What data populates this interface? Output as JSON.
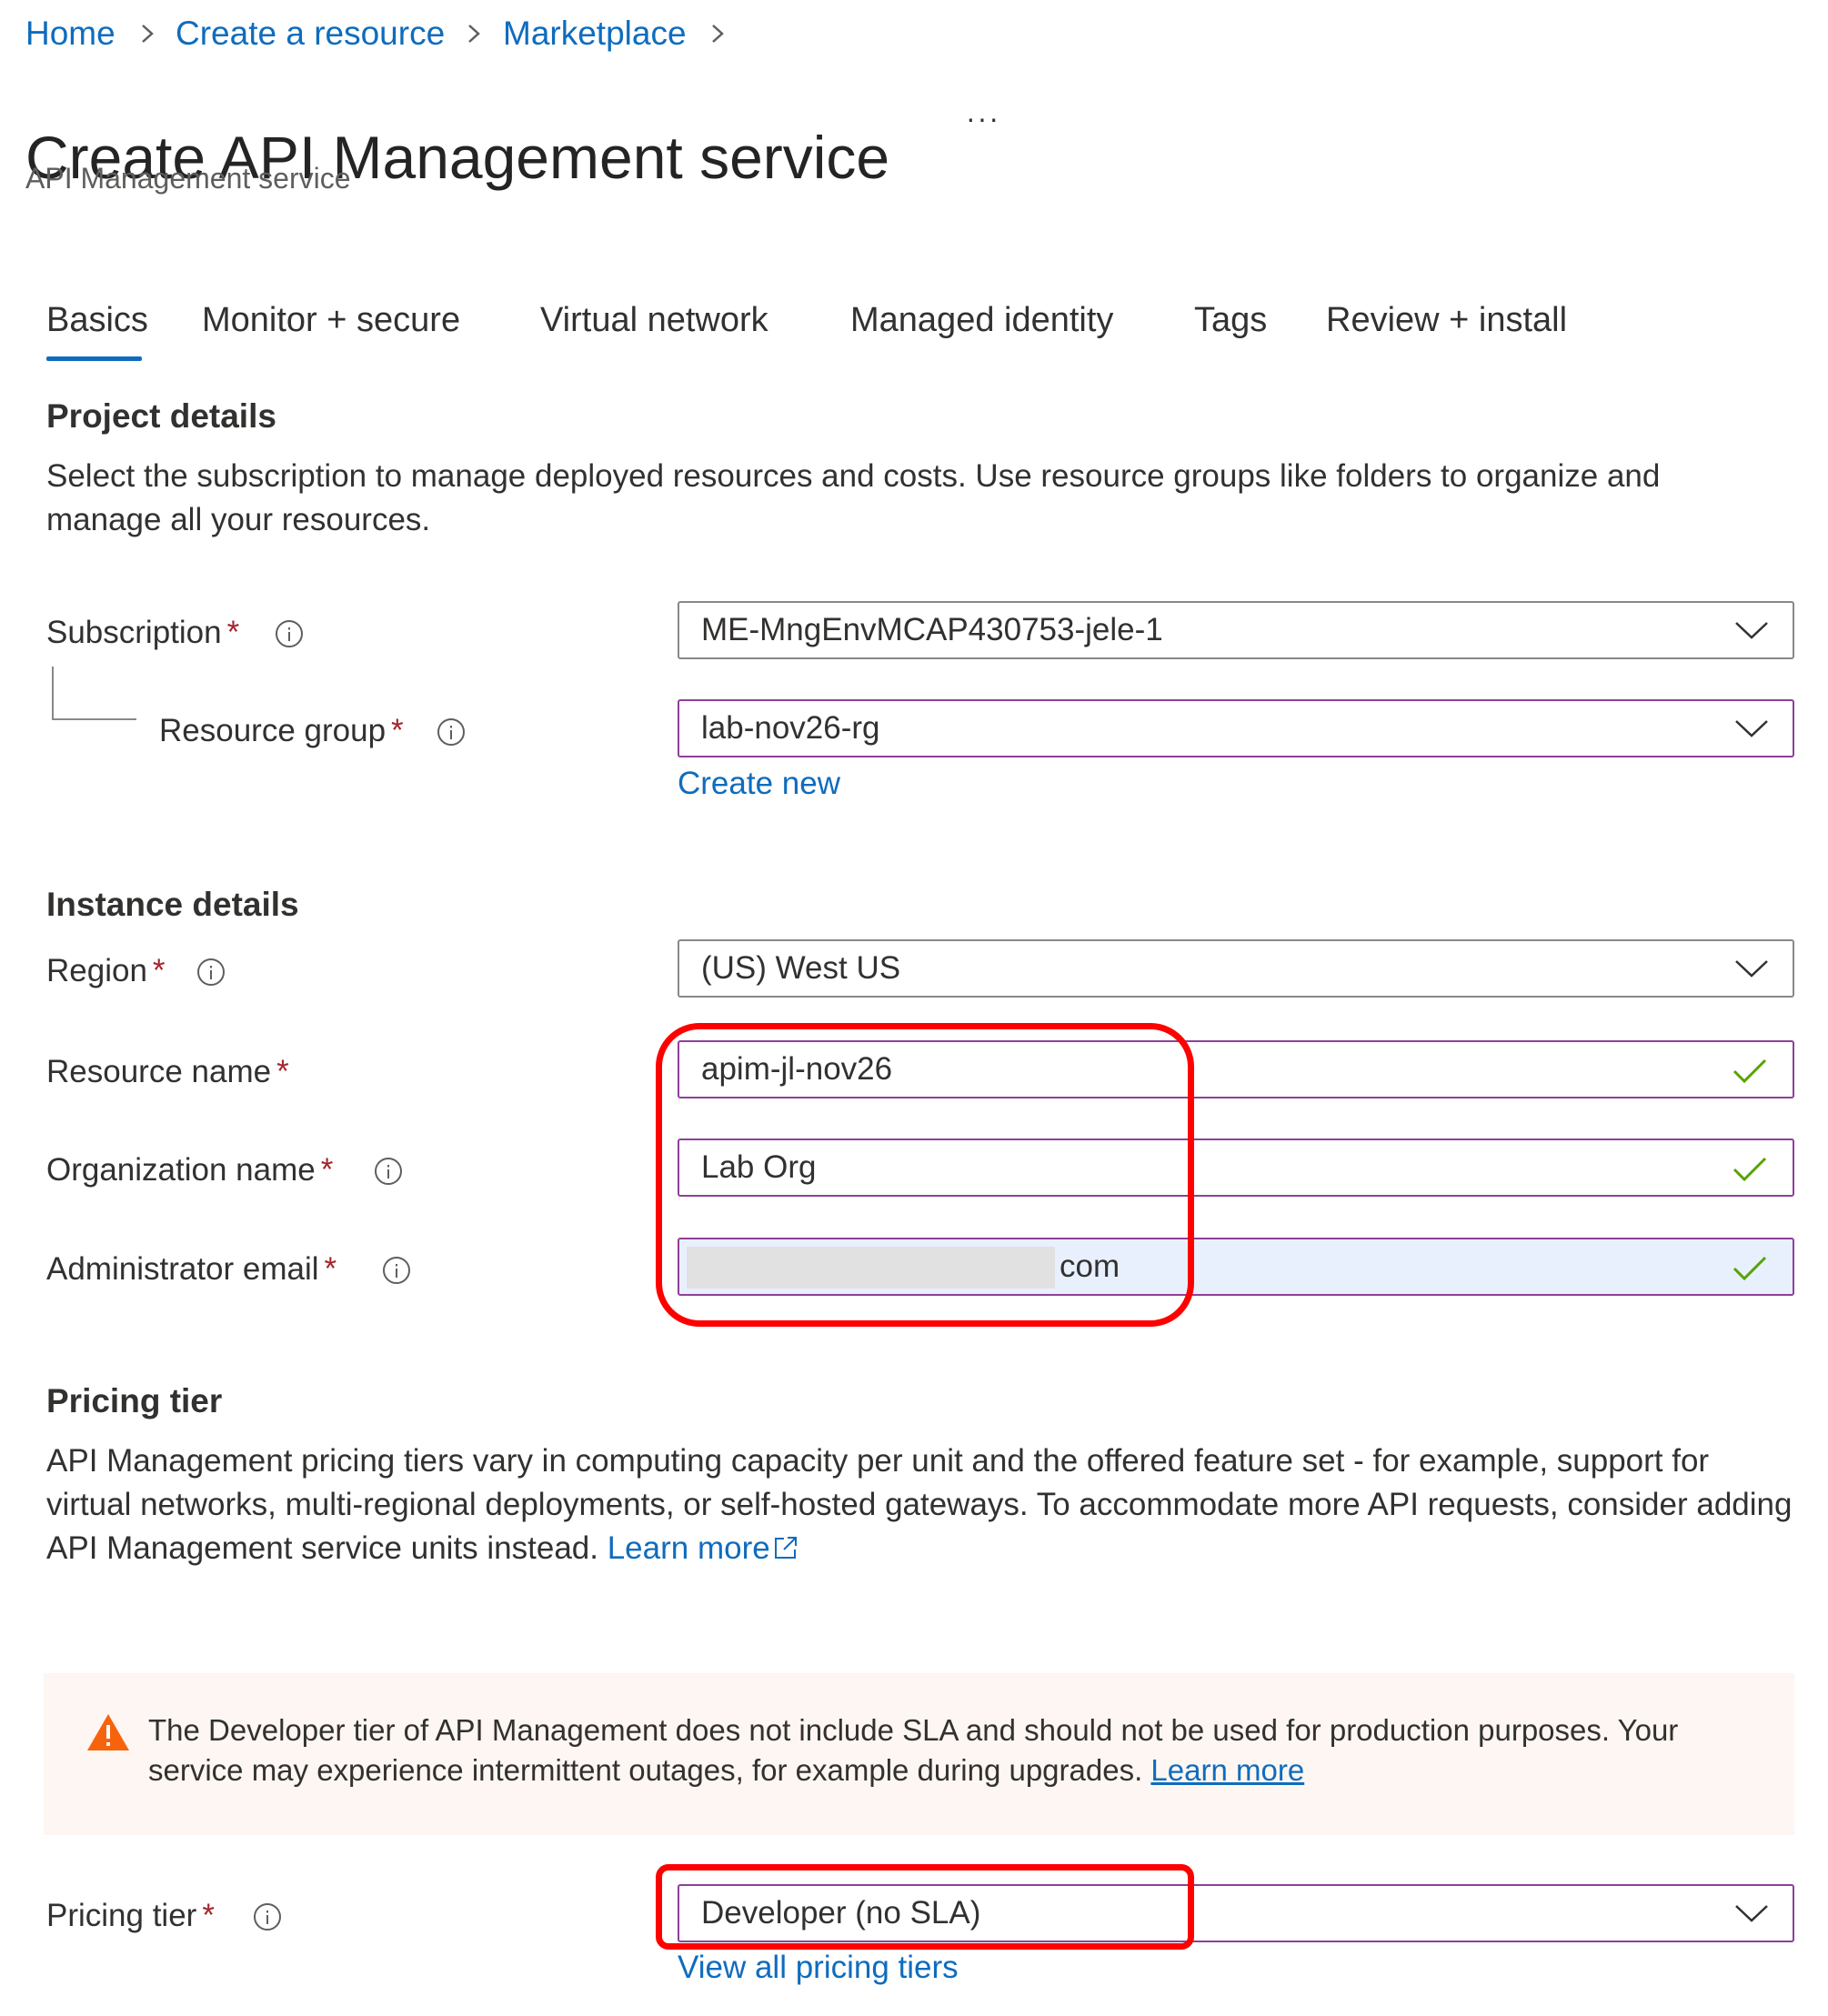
{
  "breadcrumb": {
    "items": [
      {
        "label": "Home"
      },
      {
        "label": "Create a resource"
      },
      {
        "label": "Marketplace"
      }
    ],
    "separator": ">"
  },
  "header": {
    "title": "Create API Management service",
    "more_label": "···",
    "subtitle": "API Management service"
  },
  "tabs": [
    {
      "label": "Basics",
      "active": true
    },
    {
      "label": "Monitor + secure"
    },
    {
      "label": "Virtual network"
    },
    {
      "label": "Managed identity"
    },
    {
      "label": "Tags"
    },
    {
      "label": "Review + install"
    }
  ],
  "project_details": {
    "title": "Project details",
    "description": "Select the subscription to manage deployed resources and costs. Use resource groups like folders to organize and manage all your resources.",
    "subscription": {
      "label": "Subscription",
      "required": "*",
      "value": "ME-MngEnvMCAP430753-jele-1"
    },
    "resource_group": {
      "label": "Resource group",
      "required": "*",
      "value": "lab-nov26-rg",
      "create_new": "Create new"
    }
  },
  "instance_details": {
    "title": "Instance details",
    "region": {
      "label": "Region",
      "required": "*",
      "value": "(US) West US"
    },
    "resource_name": {
      "label": "Resource name",
      "required": "*",
      "value": "apim-jl-nov26"
    },
    "organization_name": {
      "label": "Organization name",
      "required": "*",
      "value": "Lab Org"
    },
    "admin_email": {
      "label": "Administrator email",
      "required": "*",
      "value_visible": "com"
    }
  },
  "pricing": {
    "title": "Pricing tier",
    "description": "API Management pricing tiers vary in computing capacity per unit and the offered feature set - for example, support for virtual networks, multi-regional deployments, or self-hosted gateways. To accommodate more API requests, consider adding API Management service units instead.",
    "learn_more": "Learn more",
    "warning_text": "The Developer tier of API Management does not include SLA and should not be used for production purposes. Your service may experience intermittent outages, for example during upgrades.",
    "warning_learn_more": "Learn more",
    "tier": {
      "label": "Pricing tier",
      "required": "*",
      "value": "Developer (no SLA)"
    },
    "view_all": "View all pricing tiers"
  },
  "colors": {
    "link": "#0f6cbd",
    "purple_border": "#8f3f9b",
    "valid_check": "#57a300",
    "warning": "#f7630c",
    "annotation": "#ff0000"
  },
  "icons": {
    "info": "info-circle-icon",
    "chevron": "chevron-down-icon",
    "check": "checkmark-icon",
    "warning": "warning-triangle-icon",
    "external": "external-link-icon"
  }
}
